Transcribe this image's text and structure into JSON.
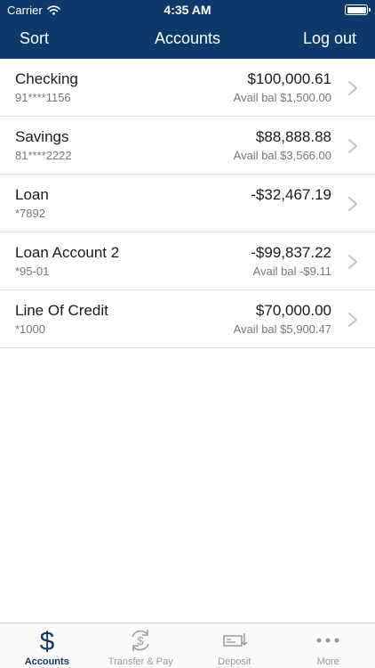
{
  "status_bar": {
    "carrier": "Carrier",
    "time": "4:35 AM"
  },
  "nav": {
    "left": "Sort",
    "title": "Accounts",
    "right": "Log out"
  },
  "accounts": [
    {
      "name": "Checking",
      "number": "91****1156",
      "balance": "$100,000.61",
      "available": "Avail bal $1,500.00"
    },
    {
      "name": "Savings",
      "number": "81****2222",
      "balance": "$88,888.88",
      "available": "Avail bal $3,566.00"
    },
    {
      "name": "Loan",
      "number": "*7892",
      "balance": "-$32,467.19",
      "available": ""
    },
    {
      "name": "Loan Account 2",
      "number": "*95-01",
      "balance": "-$99,837.22",
      "available": "Avail bal -$9.11"
    },
    {
      "name": "Line Of Credit",
      "number": "*1000",
      "balance": "$70,000.00",
      "available": "Avail bal $5,900.47"
    }
  ],
  "tabs": [
    {
      "label": "Accounts",
      "icon": "dollar-icon",
      "active": true
    },
    {
      "label": "Transfer & Pay",
      "icon": "transfer-icon",
      "active": false
    },
    {
      "label": "Deposit",
      "icon": "check-deposit-icon",
      "active": false
    },
    {
      "label": "More",
      "icon": "more-icon",
      "active": false
    }
  ],
  "colors": {
    "header": "#0e3a6b",
    "active_tab": "#0e3a6b",
    "inactive_tab": "#999999"
  }
}
